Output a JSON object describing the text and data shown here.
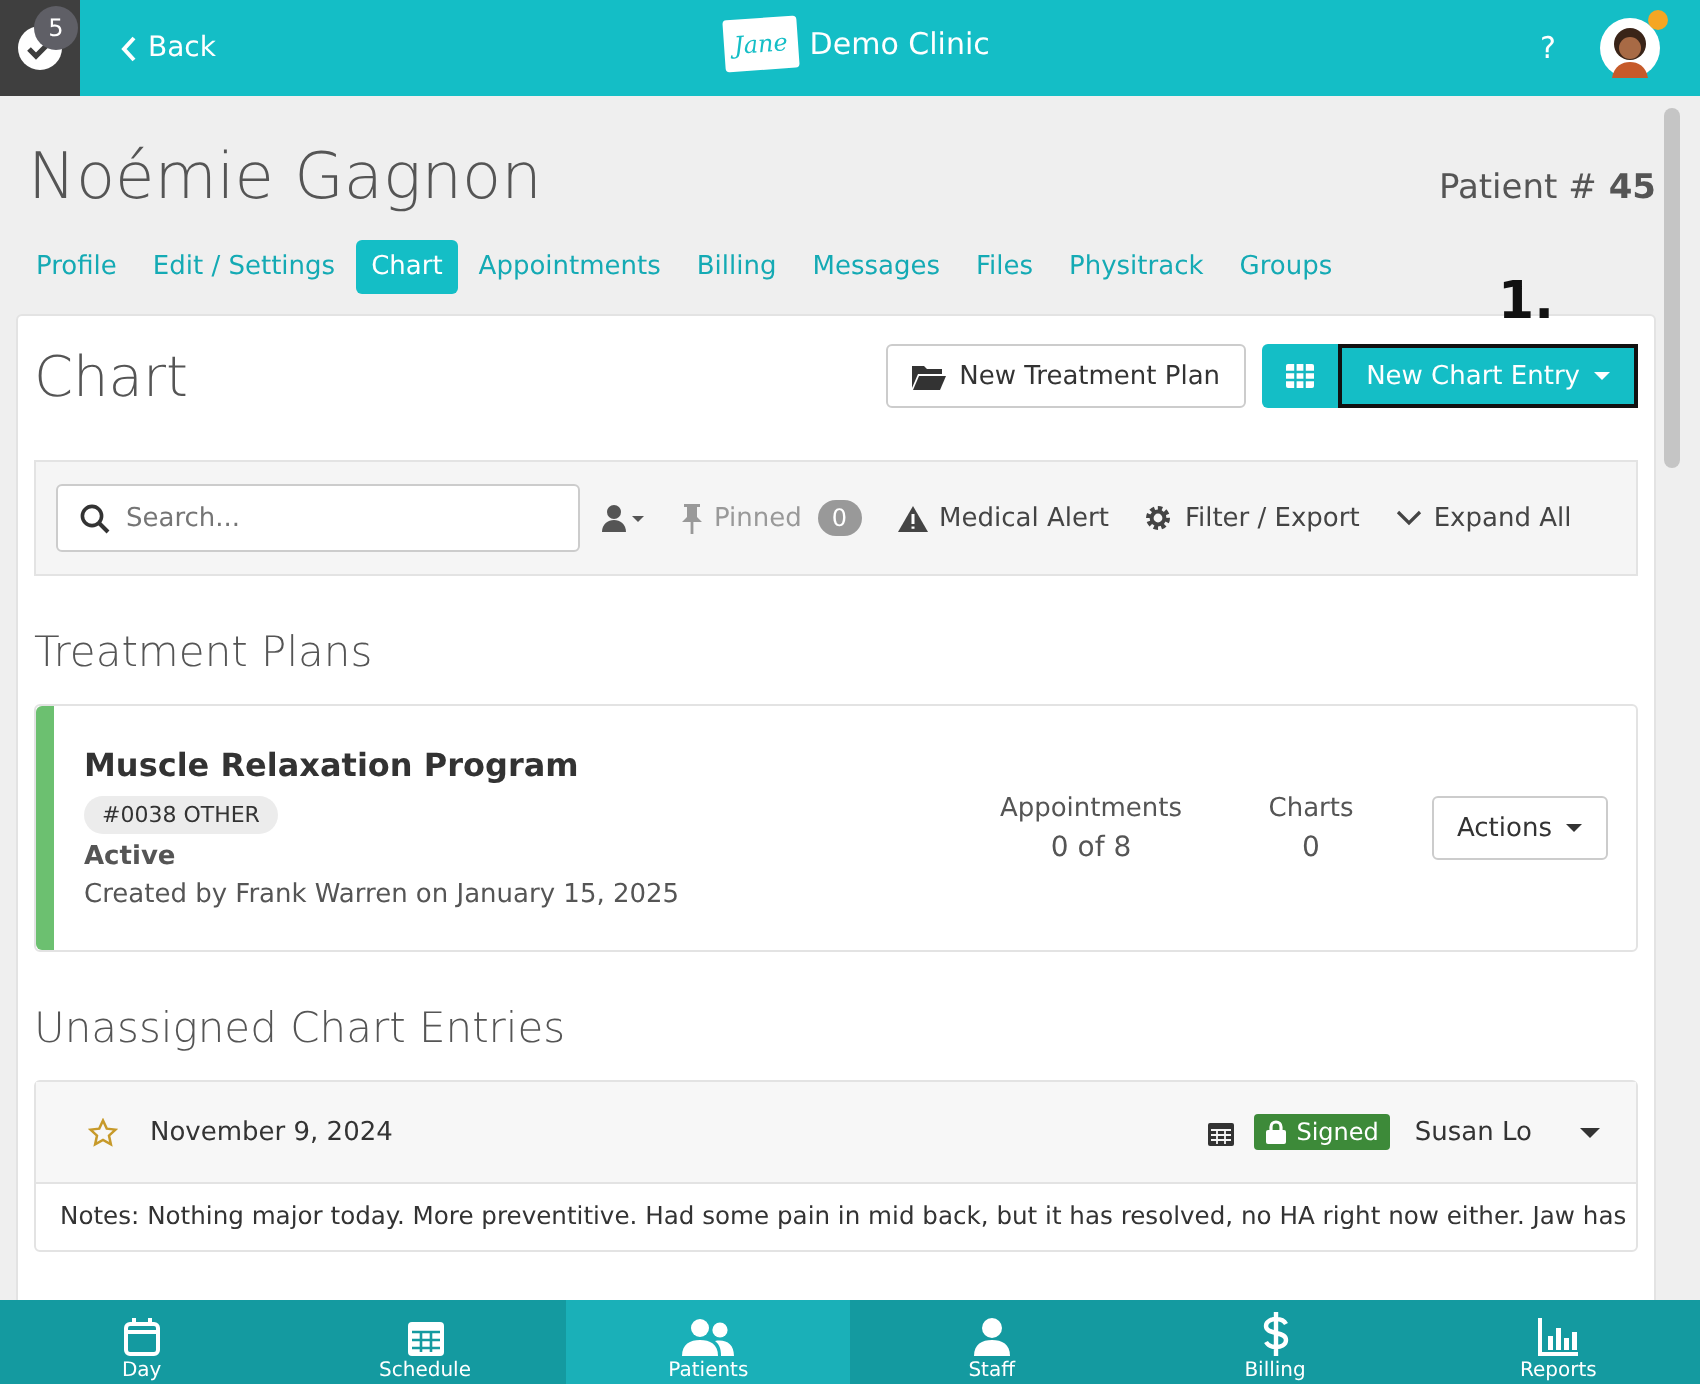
{
  "header": {
    "badge": "5",
    "back": "Back",
    "logo": "Jane",
    "clinic": "Demo Clinic",
    "help": "?",
    "notification_dot": true
  },
  "patient": {
    "name": "Noémie Gagnon",
    "number_label": "Patient #",
    "number": "45"
  },
  "tabs": [
    {
      "label": "Profile",
      "selected": false
    },
    {
      "label": "Edit / Settings",
      "selected": false
    },
    {
      "label": "Chart",
      "selected": true
    },
    {
      "label": "Appointments",
      "selected": false
    },
    {
      "label": "Billing",
      "selected": false
    },
    {
      "label": "Messages",
      "selected": false
    },
    {
      "label": "Files",
      "selected": false
    },
    {
      "label": "Physitrack",
      "selected": false
    },
    {
      "label": "Groups",
      "selected": false
    }
  ],
  "chart": {
    "title": "Chart",
    "new_plan": "New Treatment Plan",
    "new_entry": "New Chart Entry",
    "annotation": "1."
  },
  "toolbar": {
    "search_placeholder": "Search...",
    "pinned": "Pinned",
    "pinned_count": "0",
    "medical_alert": "Medical Alert",
    "filter": "Filter / Export",
    "expand": "Expand All"
  },
  "treatment_plans": {
    "heading": "Treatment Plans",
    "plans": [
      {
        "name": "Muscle Relaxation Program",
        "tag": "#0038 OTHER",
        "status": "Active",
        "color": "#6cc070",
        "created": "Created by Frank Warren on January 15, 2025",
        "appointments_label": "Appointments",
        "appointments": "0 of 8",
        "charts_label": "Charts",
        "charts": "0",
        "actions": "Actions"
      }
    ]
  },
  "unassigned": {
    "heading": "Unassigned Chart Entries",
    "entries": [
      {
        "starred": false,
        "date": "November 9, 2024",
        "signed": true,
        "signed_label": "Signed",
        "author": "Susan Lo",
        "notes": "Notes: Nothing major today. More preventitive. Had some pain in mid back, but it has resolved, no HA right now either. Jaw has"
      }
    ]
  },
  "bottom_nav": [
    {
      "label": "Day",
      "kind": "calendar",
      "selected": false
    },
    {
      "label": "Schedule",
      "kind": "grid",
      "selected": false
    },
    {
      "label": "Patients",
      "kind": "people",
      "selected": true
    },
    {
      "label": "Staff",
      "kind": "person",
      "selected": false
    },
    {
      "label": "Billing",
      "kind": "dollar",
      "selected": false
    },
    {
      "label": "Reports",
      "kind": "chart",
      "selected": false
    }
  ]
}
